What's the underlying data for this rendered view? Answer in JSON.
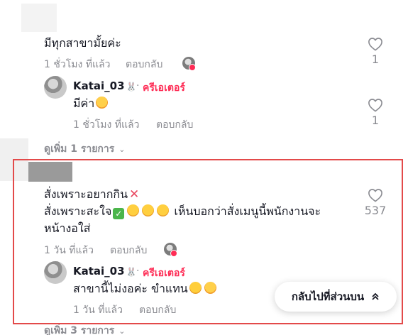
{
  "comments": [
    {
      "text": "มีทุกสาขามั้ยค่ะ",
      "time": "1 ชั่วโมง ที่แล้ว",
      "reply_label": "ตอบกลับ",
      "likes": "1",
      "reply": {
        "username": "Katai_03",
        "separator": "·",
        "creator_tag": "ครีเอเตอร์",
        "text": "มีค่า",
        "time": "1 ชั่วโมง ที่แล้ว",
        "reply_label": "ตอบกลับ",
        "likes": "1"
      },
      "view_more": "ดูเพิ่ม 1 รายการ"
    },
    {
      "text_line1": "สั่งเพราะอยากกิน",
      "text_line2": "สั่งเพราะสะใจ",
      "text_line2_after": "เห็นบอกว่าสั่งเมนูนี้พนักงานจะ",
      "text_line3": "หน้างอใส่",
      "time": "1 วัน ที่แล้ว",
      "reply_label": "ตอบกลับ",
      "likes": "537",
      "reply": {
        "username": "Katai_03",
        "separator": "·",
        "creator_tag": "ครีเอเตอร์",
        "text": "สาขานี้ไม่งอค่ะ ขำแทน",
        "time": "1 วัน ที่แล้ว",
        "reply_label": "ตอบกลับ"
      },
      "view_more": "ดูเพิ่ม 3 รายการ"
    }
  ],
  "back_to_top": "กลับไปที่ส่วนบน",
  "colors": {
    "creator": "#fe2c55",
    "highlight": "#e34a4a",
    "muted": "#8a8b91"
  }
}
